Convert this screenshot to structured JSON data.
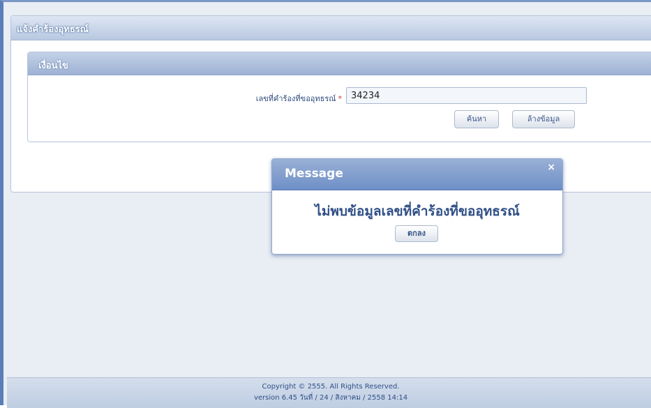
{
  "page": {
    "title": "แจ้งคำร้องอุทธรณ์"
  },
  "criteria": {
    "title": "เงื่อนไข",
    "field_label": "เลขที่คำร้องที่ขออุทธรณ์",
    "required_mark": "*",
    "field_value": "34234",
    "search_label": "ค้นหา",
    "clear_label": "ล้างข้อมูล"
  },
  "dialog": {
    "title": "Message",
    "close_icon": "×",
    "message": "ไม่พบข้อมูลเลขที่คำร้องที่ขออุทธรณ์",
    "ok_label": "ตกลง"
  },
  "footer": {
    "copyright": "Copyright © 2555. All Rights Reserved.",
    "version": "version 6.45 วันที่ / 24 / สิงหาคม / 2558 14:14"
  },
  "colors": {
    "accent": "#6e8fc6",
    "header_text": "#2f4f86"
  }
}
